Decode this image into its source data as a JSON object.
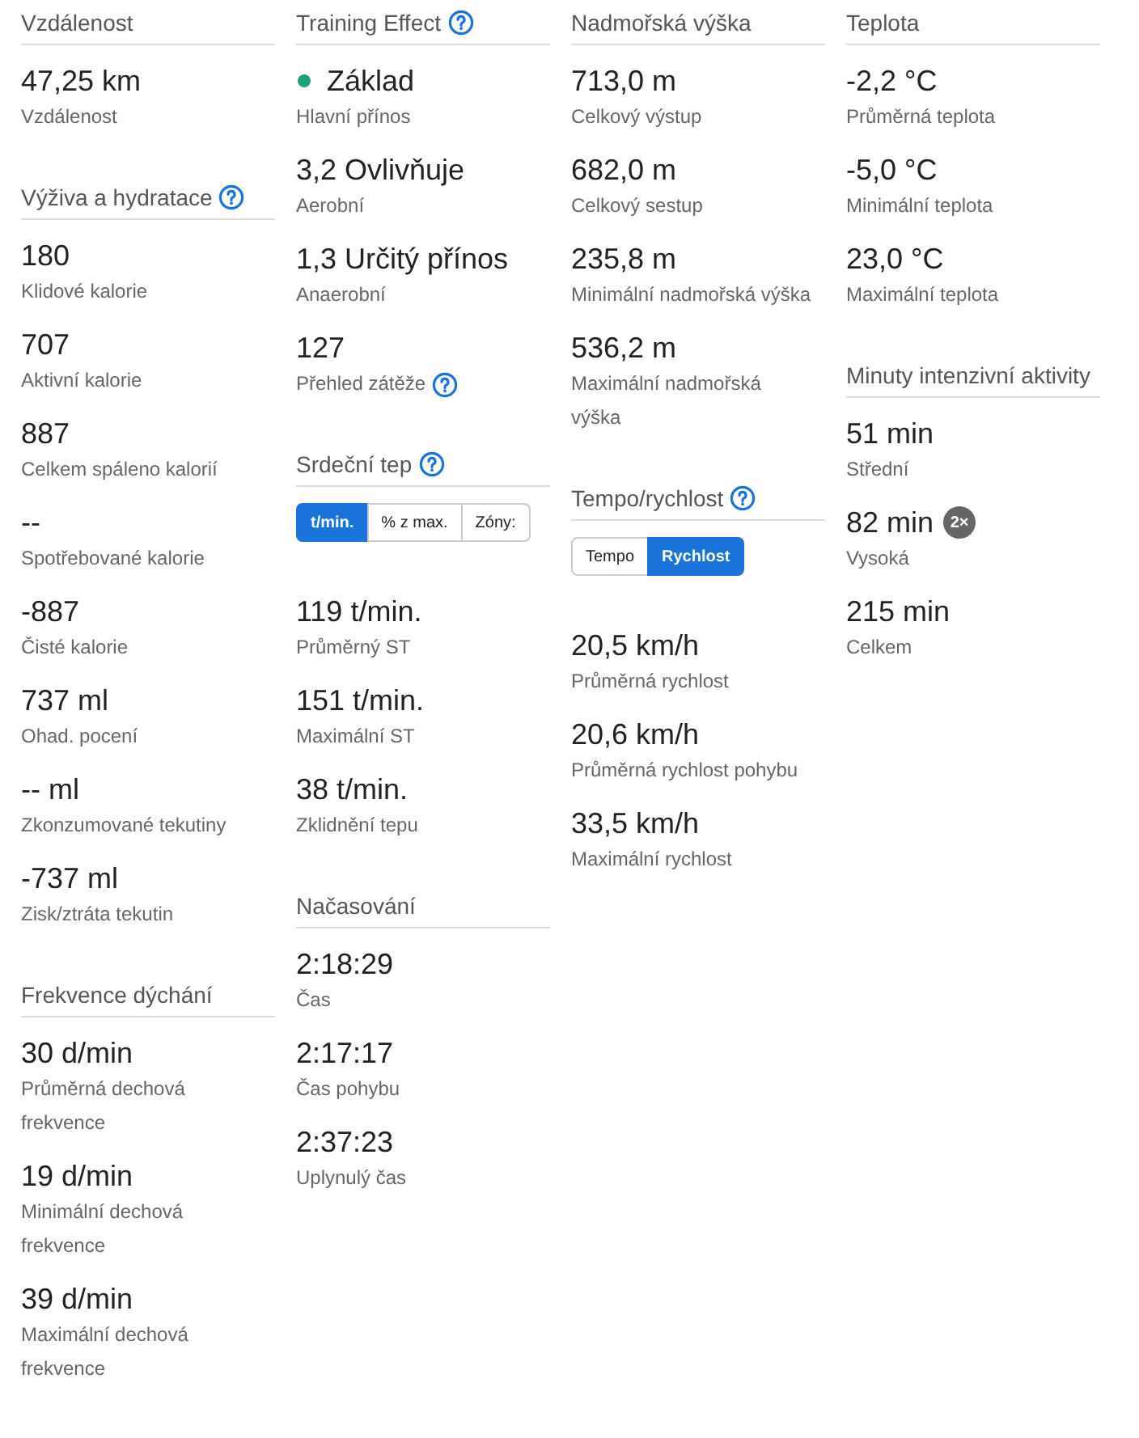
{
  "columns": [
    {
      "sections": [
        {
          "title": "Vzdálenost",
          "help": false,
          "stats": [
            {
              "value": "47,25 km",
              "label": "Vzdálenost",
              "help": false
            }
          ]
        },
        {
          "title": "Výživa a hydratace",
          "help": true,
          "stats": [
            {
              "value": "180",
              "label": "Klidové kalorie",
              "help": false
            },
            {
              "value": "707",
              "label": "Aktivní kalorie",
              "help": false
            },
            {
              "value": "887",
              "label": "Celkem spáleno kalorií",
              "help": false
            },
            {
              "value": "--",
              "label": "Spotřebované kalorie",
              "help": false
            },
            {
              "value": "-887",
              "label": "Čisté kalorie",
              "help": false
            },
            {
              "value": "737 ml",
              "label": "Ohad. pocení",
              "help": false
            },
            {
              "value": "-- ml",
              "label": "Zkonzumované tekutiny",
              "help": false
            },
            {
              "value": "-737 ml",
              "label": "Zisk/ztráta tekutin",
              "help": false
            }
          ]
        },
        {
          "title": "Frekvence dýchání",
          "help": false,
          "stats": [
            {
              "value": "30 d/min",
              "label": "Průměrná dechová frekvence",
              "help": false
            },
            {
              "value": "19 d/min",
              "label": "Minimální dechová frekvence",
              "help": false
            },
            {
              "value": "39 d/min",
              "label": "Maximální dechová frekvence",
              "help": false
            }
          ]
        }
      ]
    },
    {
      "sections": [
        {
          "title": "Training Effect",
          "help": true,
          "stats": [
            {
              "value": "Základ",
              "label": "Hlavní přínos",
              "help": false,
              "color": "#1aa37a"
            },
            {
              "value": "3,2 Ovlivňuje",
              "label": "Aerobní",
              "help": false
            },
            {
              "value": "1,3 Určitý přínos",
              "label": "Anaerobní",
              "help": false
            },
            {
              "value": "127",
              "label": "Přehled zátěže",
              "help": true
            }
          ]
        },
        {
          "title": "Srdeční tep",
          "help": true,
          "control": [
            {
              "label": "t/min.",
              "selected": true
            },
            {
              "label": "% z max.",
              "selected": false
            },
            {
              "label": "Zóny:",
              "selected": false
            }
          ],
          "stats": [
            {
              "value": "119 t/min.",
              "label": "Průměrný ST",
              "help": false
            },
            {
              "value": "151 t/min.",
              "label": "Maximální ST",
              "help": false
            },
            {
              "value": "38 t/min.",
              "label": "Zklidnění tepu",
              "help": false
            }
          ]
        },
        {
          "title": "Načasování",
          "help": false,
          "stats": [
            {
              "value": "2:18:29",
              "label": "Čas",
              "help": false
            },
            {
              "value": "2:17:17",
              "label": "Čas pohybu",
              "help": false
            },
            {
              "value": "2:37:23",
              "label": "Uplynulý čas",
              "help": false
            }
          ]
        }
      ]
    },
    {
      "sections": [
        {
          "title": "Nadmořská výška",
          "help": false,
          "stats": [
            {
              "value": "713,0 m",
              "label": "Celkový výstup",
              "help": false
            },
            {
              "value": "682,0 m",
              "label": "Celkový sestup",
              "help": false
            },
            {
              "value": "235,8 m",
              "label": "Minimální nadmořská výška",
              "help": false
            },
            {
              "value": "536,2 m",
              "label": "Maximální nadmořská výška",
              "help": false
            }
          ]
        },
        {
          "title": "Tempo/rychlost",
          "help": true,
          "control": [
            {
              "label": "Tempo",
              "selected": false
            },
            {
              "label": "Rychlost",
              "selected": true
            }
          ],
          "stats": [
            {
              "value": "20,5 km/h",
              "label": "Průměrná rychlost",
              "help": false
            },
            {
              "value": "20,6 km/h",
              "label": "Průměrná rychlost pohybu",
              "help": false
            },
            {
              "value": "33,5 km/h",
              "label": "Maximální rychlost",
              "help": false
            }
          ]
        }
      ]
    },
    {
      "sections": [
        {
          "title": "Teplota",
          "help": false,
          "stats": [
            {
              "value": "-2,2 °C",
              "label": "Průměrná teplota",
              "help": false
            },
            {
              "value": "-5,0 °C",
              "label": "Minimální teplota",
              "help": false
            },
            {
              "value": "23,0 °C",
              "label": "Maximální teplota",
              "help": false
            }
          ]
        },
        {
          "title": "Minuty intenzivní aktivity",
          "help": false,
          "stats": [
            {
              "value": "51 min",
              "label": "Střední",
              "help": false
            },
            {
              "value": "82 min",
              "label": "Vysoká",
              "help": false,
              "badge": "2×"
            },
            {
              "value": "215 min",
              "label": "Celkem",
              "help": false
            }
          ]
        }
      ]
    }
  ]
}
